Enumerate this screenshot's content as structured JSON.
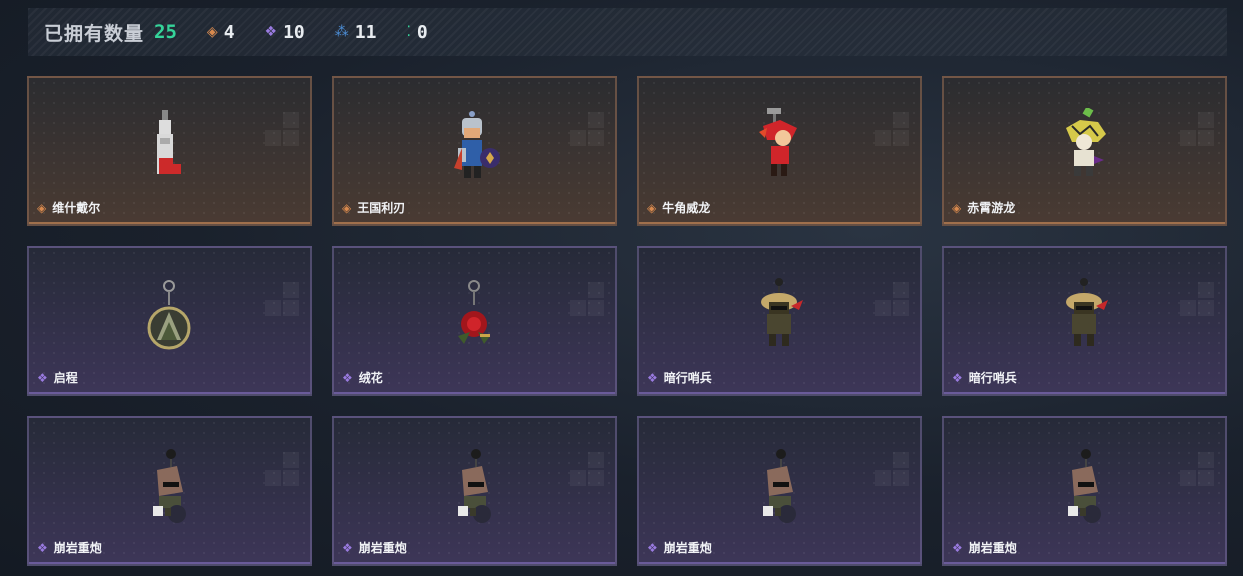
{
  "header": {
    "title": "已拥有数量",
    "total": "25",
    "counters": [
      {
        "icon": "orange-diamond-icon",
        "glyph": "◈",
        "color": "#d98a4e",
        "value": "4"
      },
      {
        "icon": "purple-diamond-icon",
        "glyph": "❖",
        "color": "#9a7be0",
        "value": "10"
      },
      {
        "icon": "blue-cluster-icon",
        "glyph": "⁂",
        "color": "#4c8fd8",
        "value": "11"
      },
      {
        "icon": "green-dots-icon",
        "glyph": "⁚",
        "color": "#35d49a",
        "value": "0"
      }
    ]
  },
  "colors": {
    "orange": "#d98a4e",
    "purple": "#9a7be0"
  },
  "items": [
    {
      "name": "维什戴尔",
      "rarity": "orange",
      "art": "tall-box"
    },
    {
      "name": "王国利刃",
      "rarity": "orange",
      "art": "knight"
    },
    {
      "name": "牛角威龙",
      "rarity": "orange",
      "art": "red-dragon"
    },
    {
      "name": "赤霄游龙",
      "rarity": "orange",
      "art": "yellow-dragon"
    },
    {
      "name": "启程",
      "rarity": "purple",
      "art": "medal"
    },
    {
      "name": "绒花",
      "rarity": "purple",
      "art": "rose"
    },
    {
      "name": "暗行哨兵",
      "rarity": "purple",
      "art": "sentinel"
    },
    {
      "name": "暗行哨兵",
      "rarity": "purple",
      "art": "sentinel"
    },
    {
      "name": "崩岩重炮",
      "rarity": "purple",
      "art": "rock-gunner"
    },
    {
      "name": "崩岩重炮",
      "rarity": "purple",
      "art": "rock-gunner"
    },
    {
      "name": "崩岩重炮",
      "rarity": "purple",
      "art": "rock-gunner"
    },
    {
      "name": "崩岩重炮",
      "rarity": "purple",
      "art": "rock-gunner"
    }
  ]
}
